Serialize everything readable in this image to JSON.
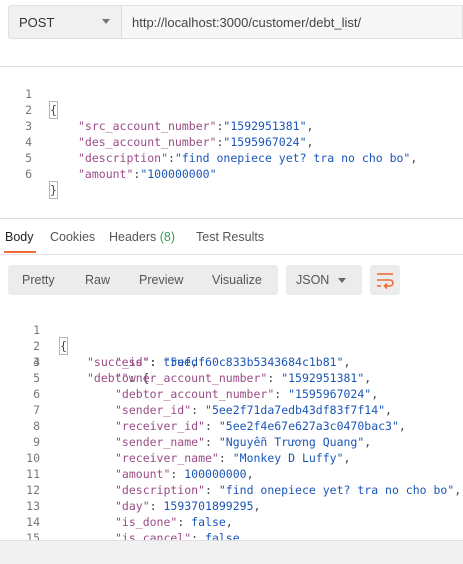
{
  "request": {
    "method": "POST",
    "url": "http://localhost:3000/customer/debt_list/"
  },
  "request_body": {
    "line_numbers": [
      "1",
      "2",
      "3",
      "4",
      "5",
      "6"
    ],
    "open_brace": "{",
    "close_brace": "}",
    "fields": [
      {
        "key": "\"src_account_number\"",
        "value": "\"1592951381\"",
        "suffix": ","
      },
      {
        "key": "\"des_account_number\"",
        "value": "\"1595967024\"",
        "suffix": ","
      },
      {
        "key": "\"description\"",
        "value": "\"find onepiece yet? tra no cho bo\"",
        "suffix": ","
      },
      {
        "key": "\"amount\"",
        "value": "\"100000000\"",
        "suffix": ""
      }
    ]
  },
  "response_tabs": {
    "body": "Body",
    "cookies": "Cookies",
    "headers": "Headers",
    "headers_count": "(8)",
    "tests": "Test Results"
  },
  "view_options": {
    "pretty": "Pretty",
    "raw": "Raw",
    "preview": "Preview",
    "visualize": "Visualize",
    "format": "JSON"
  },
  "response_body": {
    "line_numbers": [
      "1",
      "2",
      "3",
      "4",
      "5",
      "6",
      "7",
      "8",
      "9",
      "10",
      "11",
      "12",
      "13",
      "14",
      "15"
    ],
    "open_brace": "{",
    "success_key": "\"success\"",
    "success_value": "true",
    "debt_key": "\"debt\"",
    "debt_open": "{",
    "fields": [
      {
        "key": "\"_id\"",
        "value": "\"5efdf60c833b5343684c1b81\"",
        "suffix": ","
      },
      {
        "key": "\"owner_account_number\"",
        "value": "\"1592951381\"",
        "suffix": ","
      },
      {
        "key": "\"debtor_account_number\"",
        "value": "\"1595967024\"",
        "suffix": ","
      },
      {
        "key": "\"sender_id\"",
        "value": "\"5ee2f71da7edb43df83f7f14\"",
        "suffix": ","
      },
      {
        "key": "\"receiver_id\"",
        "value": "\"5ee2f4e67e627a3c0470bac3\"",
        "suffix": ","
      },
      {
        "key": "\"sender_name\"",
        "value": "\"Nguyễn Trương Quang\"",
        "suffix": ","
      },
      {
        "key": "\"receiver_name\"",
        "value": "\"Monkey D Luffy\"",
        "suffix": ","
      },
      {
        "key": "\"amount\"",
        "value": "100000000",
        "suffix": ","
      },
      {
        "key": "\"description\"",
        "value": "\"find onepiece yet? tra no cho bo\"",
        "suffix": ","
      },
      {
        "key": "\"day\"",
        "value": "1593701899295",
        "suffix": ","
      },
      {
        "key": "\"is_done\"",
        "value": "false",
        "suffix": ","
      },
      {
        "key": "\"is_cancel\"",
        "value": "false",
        "suffix": ","
      }
    ]
  },
  "colors": {
    "accent": "#f26b3a",
    "key": "#9a4b86",
    "string": "#1a56b8",
    "count": "#3a9c5f"
  },
  "icons": [
    "dropdown-caret-icon",
    "wrap-lines-icon"
  ]
}
